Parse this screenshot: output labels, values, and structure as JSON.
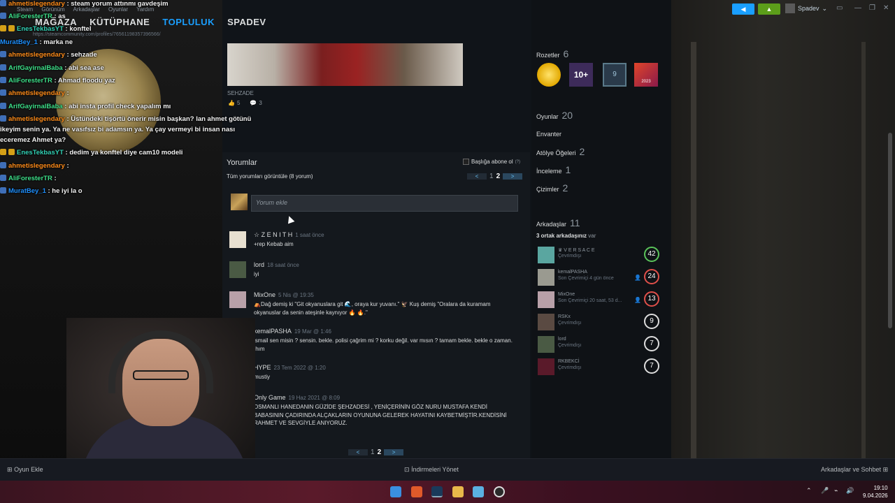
{
  "topmenu": {
    "small_items": [
      "Steam",
      "Görünüm",
      "Arkadaşlar",
      "Oyunlar",
      "Yardım"
    ],
    "nav": [
      "MAĞAZA",
      "KÜTÜPHANE",
      "TOPLULUK",
      "SPADEV"
    ],
    "active": "TOPLULUK",
    "url": "https://steamcommunity.com/profiles/76561198357396566/",
    "username": "Spadev"
  },
  "chat": [
    {
      "user": "ahmetislegendary",
      "msg": ": steam yorum attınmı gavdeşim",
      "cls": "u-orange"
    },
    {
      "user": "AliForesterTR",
      "msg": ": as",
      "cls": "u-green"
    },
    {
      "user": "EnesTekbasYT",
      "msg": ": konftel",
      "cls": "u-teal"
    },
    {
      "user": "MuratBey_1",
      "msg": ": marka ne",
      "cls": "u-blue"
    },
    {
      "user": "ahmetislegendary",
      "msg": ": sehzade",
      "cls": "u-orange"
    },
    {
      "user": "ArifGayirnalBaba",
      "msg": ": abi sea ase",
      "cls": "u-green"
    },
    {
      "user": "AliForesterTR",
      "msg": ": Ahmad floodu yaz",
      "cls": "u-green"
    },
    {
      "user": "ahmetislegendary",
      "msg": ":",
      "cls": "u-orange"
    },
    {
      "user": "ArifGayirnalBaba",
      "msg": ": abi insta profil check yapalım mı",
      "cls": "u-green"
    },
    {
      "user": "ahmetislegendary",
      "msg": ": Üstündeki tişörtü önerir misin başkan? lan ahmet götünü",
      "cls": "u-orange"
    },
    {
      "user": "",
      "msg": "ikeyim senin ya. Ya ne vasıfsız bi adamsın ya. Ya çay vermeyi bi insan nası",
      "cls": ""
    },
    {
      "user": "",
      "msg": "eceremez Ahmet ya?",
      "cls": ""
    },
    {
      "user": "EnesTekbasYT",
      "msg": ": dedim ya konftel diye cam10 modeli",
      "cls": "u-teal"
    },
    {
      "user": "ahmetislegendary",
      "msg": ":",
      "cls": "u-orange"
    },
    {
      "user": "AliForesterTR",
      "msg": ":",
      "cls": "u-green"
    },
    {
      "user": "MuratBey_1",
      "msg": ": he iyi la o",
      "cls": "u-blue"
    }
  ],
  "screenshot": {
    "title": "SEHZADE",
    "likes": "5",
    "comments": "3"
  },
  "comments_box": {
    "title": "Yorumlar",
    "view_all": "Tüm yorumları görüntüle (8 yorum)",
    "subscribe": "Başlığa abone ol",
    "subscribe_help": "(?)",
    "page_prev": "1",
    "page_current": "2",
    "placeholder": "Yorum ekle",
    "next_arrow": ">",
    "prev_arrow": "<"
  },
  "comments": [
    {
      "name": "☆ Z E N I T H",
      "time": "1 saat önce",
      "text": "+rep Kebab aim"
    },
    {
      "name": "lord",
      "time": "18 saat önce",
      "text": "iyi"
    },
    {
      "name": "MixOne",
      "time": "5 Nis @ 19:35",
      "text": "⛺Dağ demiş ki \"Git okyanuslara git 🌊, oraya kur yuvanı.\" 🦅 Kuş demiş \"Oralara da kuramam okyanuslar da senin ateşinle kaynıyor 🔥 🔥.\""
    },
    {
      "name": "kemalPASHA",
      "time": "19 Mar @ 1:46",
      "text": "ismail sen misin ? sensin. bekle. polisi çağrim mi ? korku değil. var mısın ? tamam bekle. bekle o zaman. ıhım"
    },
    {
      "name": "HYPE",
      "time": "23 Tem 2022 @ 1:20",
      "text": "mustiy"
    },
    {
      "name": "Only Game",
      "time": "19 Haz 2021 @ 8:09",
      "text": "OSMANLI HANEDANIN GÜZİDE ŞEHZADESİ , YENİÇERİNİN GÖZ NURU MUSTAFA KENDİ BABASININ ÇADIRINDA ALÇAKLARIN OYUNUNA GELEREK HAYATINI KAYBETMİŞTİR.KENDİSİNİ RAHMET VE SEVGİYLE ANIYORUZ."
    }
  ],
  "profile_stats": {
    "badges_label": "Rozetler",
    "badges_count": "6",
    "badge_10": "10+",
    "badge_9": "9",
    "badge_year": "2023",
    "games_label": "Oyunlar",
    "games_count": "20",
    "inventory_label": "Envanter",
    "workshop_label": "Atölye Öğeleri",
    "workshop_count": "2",
    "reviews_label": "İnceleme",
    "reviews_count": "1",
    "artwork_label": "Çizimler",
    "artwork_count": "2",
    "friends_label": "Arkadaşlar",
    "friends_count": "11",
    "mutual_prefix": "3 ortak arkadaşınız",
    "mutual_suffix": "var"
  },
  "friends": [
    {
      "name": "♛ V E R S A C E",
      "status": "Çevrimdışı",
      "level": "42",
      "ring": "green",
      "mutual": false
    },
    {
      "name": "kemalPASHA",
      "status": "Son Çevrimiçi 4 gün önce",
      "level": "24",
      "ring": "red",
      "mutual": true
    },
    {
      "name": "MixOne",
      "status": "Son Çevrimiçi 20 saat, 53 d...",
      "level": "13",
      "ring": "red",
      "mutual": true
    },
    {
      "name": "RSKx",
      "status": "Çevrimdışı",
      "level": "9",
      "ring": "white",
      "mutual": false
    },
    {
      "name": "lord",
      "status": "Çevrimdışı",
      "level": "7",
      "ring": "white",
      "mutual": false
    },
    {
      "name": "RKBEKCİ",
      "status": "Çevrimdışı",
      "level": "7",
      "ring": "white",
      "mutual": false
    }
  ],
  "bottom": {
    "add_game": "Oyun Ekle",
    "downloads": "İndirmeleri Yönet",
    "friends_chat": "Arkadaşlar ve Sohbet"
  },
  "taskbar": {
    "time": "19:10",
    "date": "9.04.2026"
  }
}
